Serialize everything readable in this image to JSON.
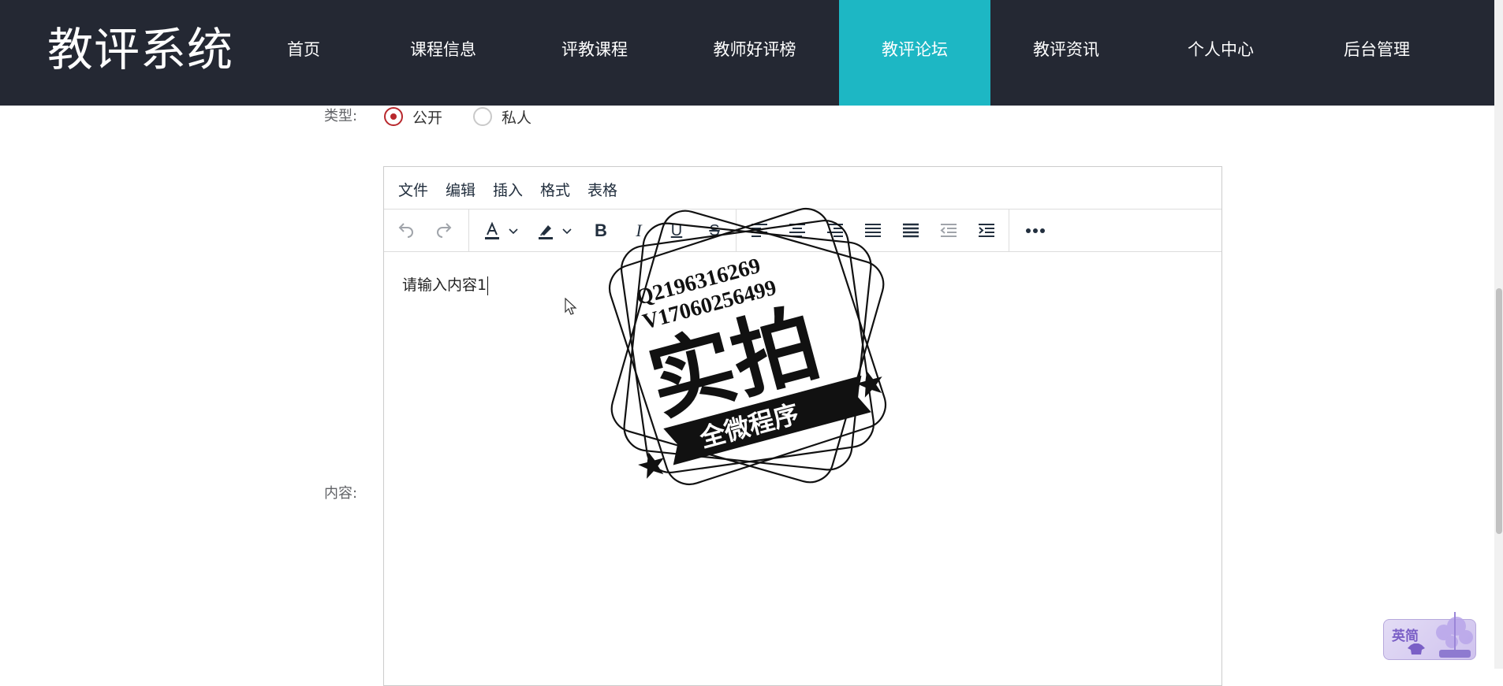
{
  "header": {
    "brand": "教评系统",
    "nav": [
      {
        "label": "首页",
        "active": false
      },
      {
        "label": "课程信息",
        "active": false
      },
      {
        "label": "评教课程",
        "active": false
      },
      {
        "label": "教师好评榜",
        "active": false
      },
      {
        "label": "教评论坛",
        "active": true
      },
      {
        "label": "教评资讯",
        "active": false
      },
      {
        "label": "个人中心",
        "active": false
      },
      {
        "label": "后台管理",
        "active": false
      }
    ]
  },
  "form": {
    "type_label": "类型:",
    "type_options": [
      {
        "label": "公开",
        "checked": true
      },
      {
        "label": "私人",
        "checked": false
      }
    ],
    "content_label": "内容:"
  },
  "editor": {
    "menus": [
      "文件",
      "编辑",
      "插入",
      "格式",
      "表格"
    ],
    "toolbar_icons": [
      "undo-icon",
      "redo-icon",
      "text-color-icon",
      "chevron-down-icon",
      "highlight-icon",
      "chevron-down-icon",
      "bold-icon",
      "italic-icon",
      "underline-icon",
      "strikethrough-icon",
      "align-left-icon",
      "align-center-icon",
      "align-right-icon",
      "align-justify-icon",
      "justify-full-icon",
      "outdent-icon",
      "indent-icon",
      "more-icon"
    ],
    "content": "请输入内容1"
  },
  "watermark": {
    "line1": "Q2196316269",
    "line2": "V17060256499",
    "main": "实拍",
    "banner": "全微程序"
  },
  "ime": {
    "label": "英简"
  },
  "colors": {
    "nav_bg": "#242833",
    "nav_active": "#1db7c4",
    "radio_checked": "#b8282d"
  }
}
